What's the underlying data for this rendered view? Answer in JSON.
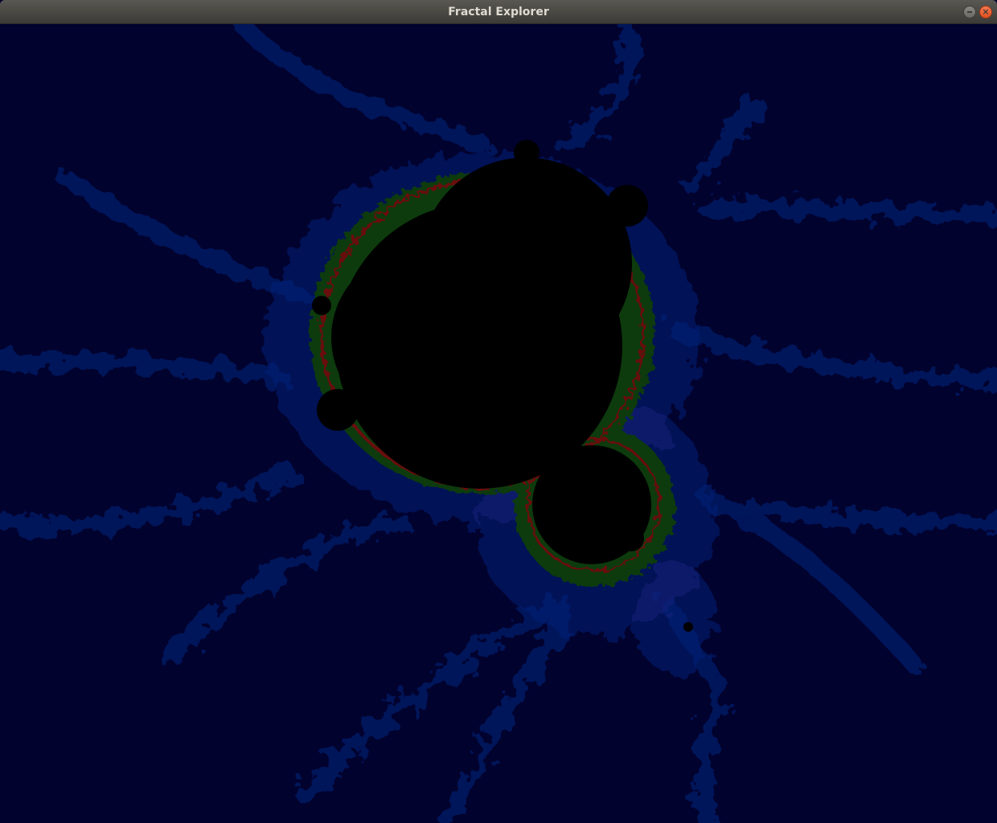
{
  "window": {
    "title": "Fractal Explorer",
    "close_glyph": "×"
  },
  "icons": {
    "minimize": "minimize-icon",
    "close": "close-icon"
  },
  "fractal": {
    "type": "mandelbrot",
    "palette": {
      "background": "#02022e",
      "cloud": "#030433",
      "filament": "#06125a",
      "halo": "#0a1f78",
      "edge_green": "#0d3a10",
      "edge_red": "#6a0f0f",
      "interior": "#000000"
    }
  }
}
